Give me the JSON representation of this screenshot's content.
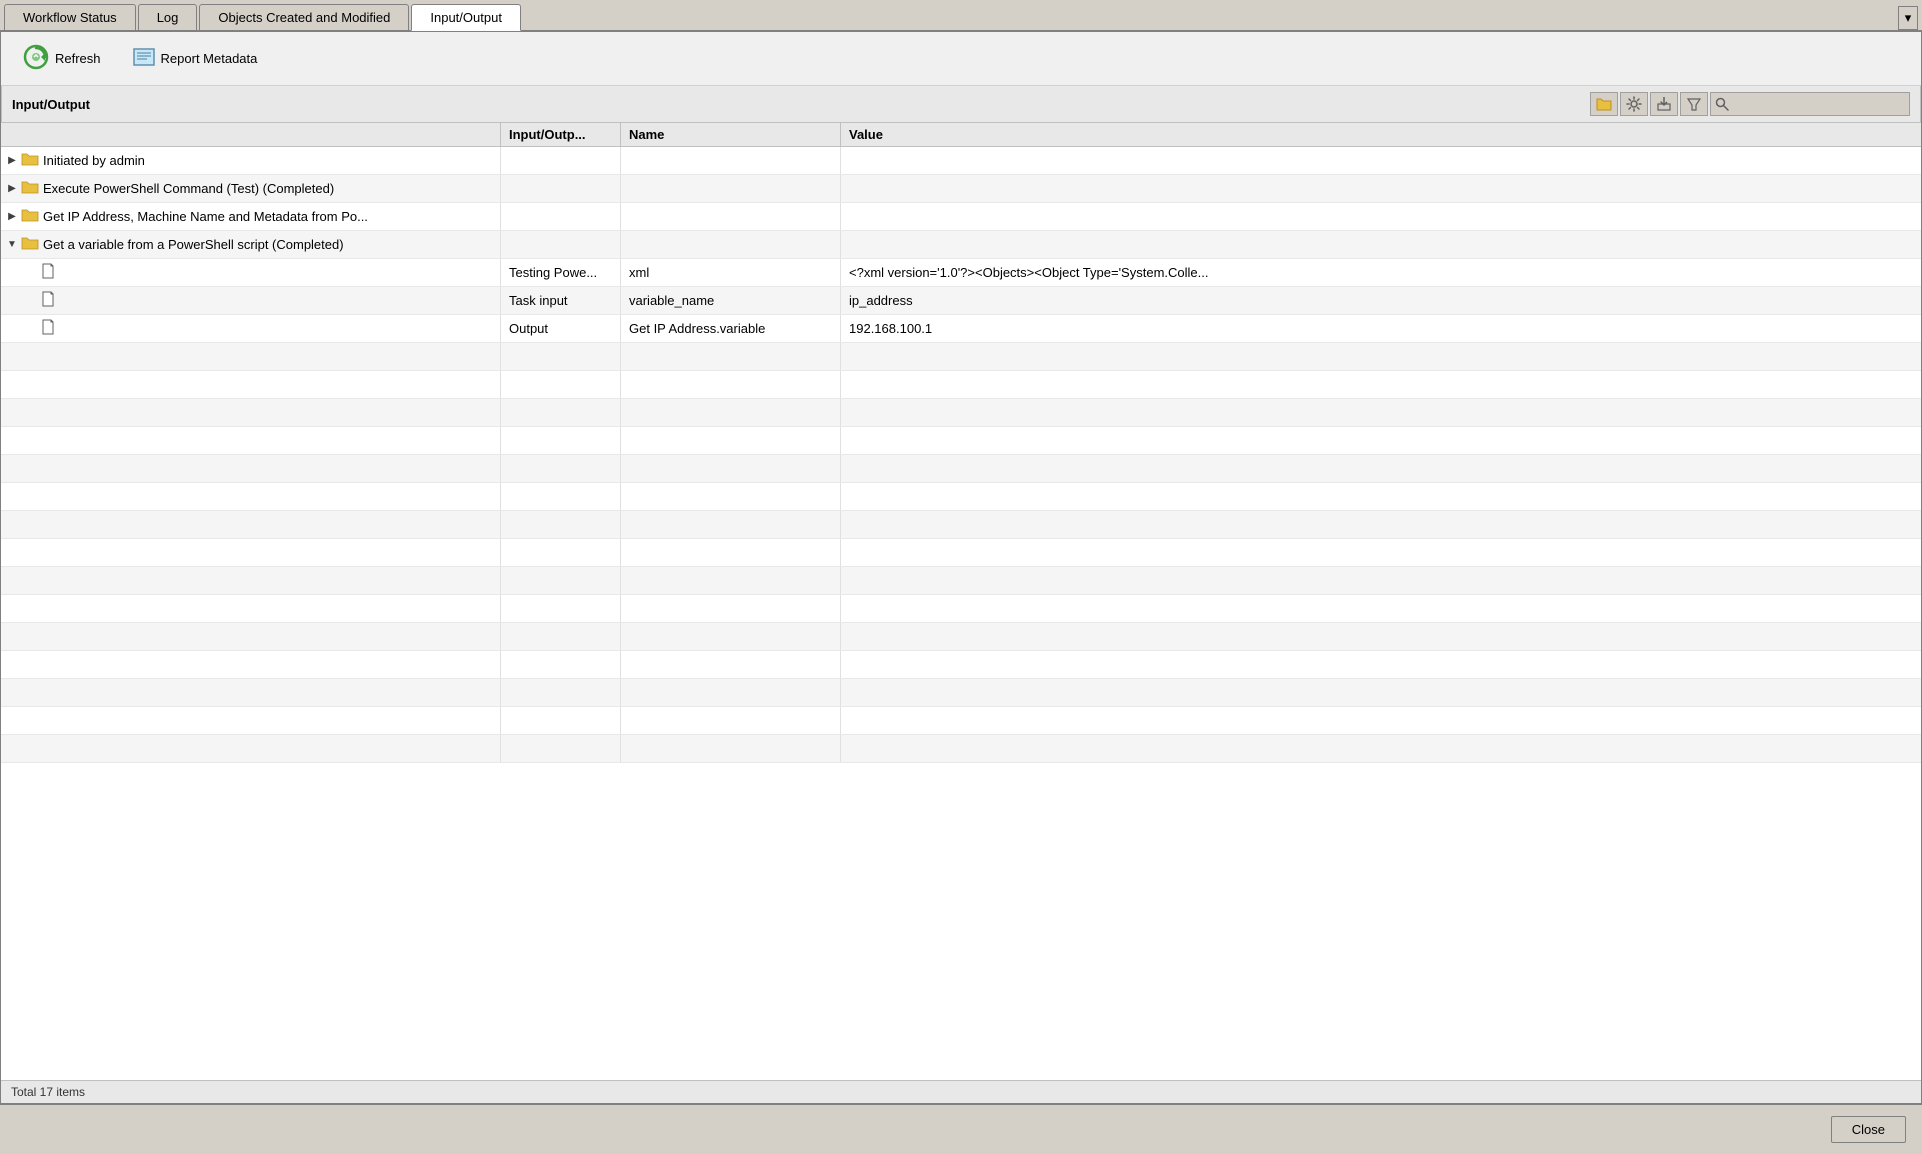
{
  "tabs": [
    {
      "id": "workflow-status",
      "label": "Workflow Status",
      "active": false
    },
    {
      "id": "log",
      "label": "Log",
      "active": false
    },
    {
      "id": "objects-created",
      "label": "Objects Created and Modified",
      "active": false
    },
    {
      "id": "input-output",
      "label": "Input/Output",
      "active": true
    }
  ],
  "toolbar": {
    "refresh_label": "Refresh",
    "report_metadata_label": "Report Metadata"
  },
  "panel": {
    "title": "Input/Output"
  },
  "table": {
    "columns": {
      "tree": "",
      "io": "Input/Outp...",
      "name": "Name",
      "value": "Value"
    },
    "rows": [
      {
        "type": "folder-collapsed",
        "indent": 0,
        "label": "Initiated by admin",
        "io": "",
        "name": "",
        "value": ""
      },
      {
        "type": "folder-collapsed",
        "indent": 0,
        "label": "Execute PowerShell Command (Test) (Completed)",
        "io": "",
        "name": "",
        "value": ""
      },
      {
        "type": "folder-collapsed",
        "indent": 0,
        "label": "Get IP Address, Machine Name and Metadata from Po...",
        "io": "",
        "name": "",
        "value": ""
      },
      {
        "type": "folder-expanded",
        "indent": 0,
        "label": "Get a variable from a PowerShell script (Completed)",
        "io": "",
        "name": "",
        "value": ""
      },
      {
        "type": "doc",
        "indent": 1,
        "label": "",
        "io": "Testing Powe...",
        "name": "xml",
        "value": "<?xml version='1.0'?><Objects><Object Type='System.Colle..."
      },
      {
        "type": "doc",
        "indent": 1,
        "label": "",
        "io": "Task input",
        "name": "variable_name",
        "value": "ip_address"
      },
      {
        "type": "doc",
        "indent": 1,
        "label": "",
        "io": "Output",
        "name": "Get IP Address.variable",
        "value": "192.168.100.1"
      }
    ]
  },
  "status_bar": {
    "text": "Total 17 items"
  },
  "close_button": {
    "label": "Close"
  }
}
